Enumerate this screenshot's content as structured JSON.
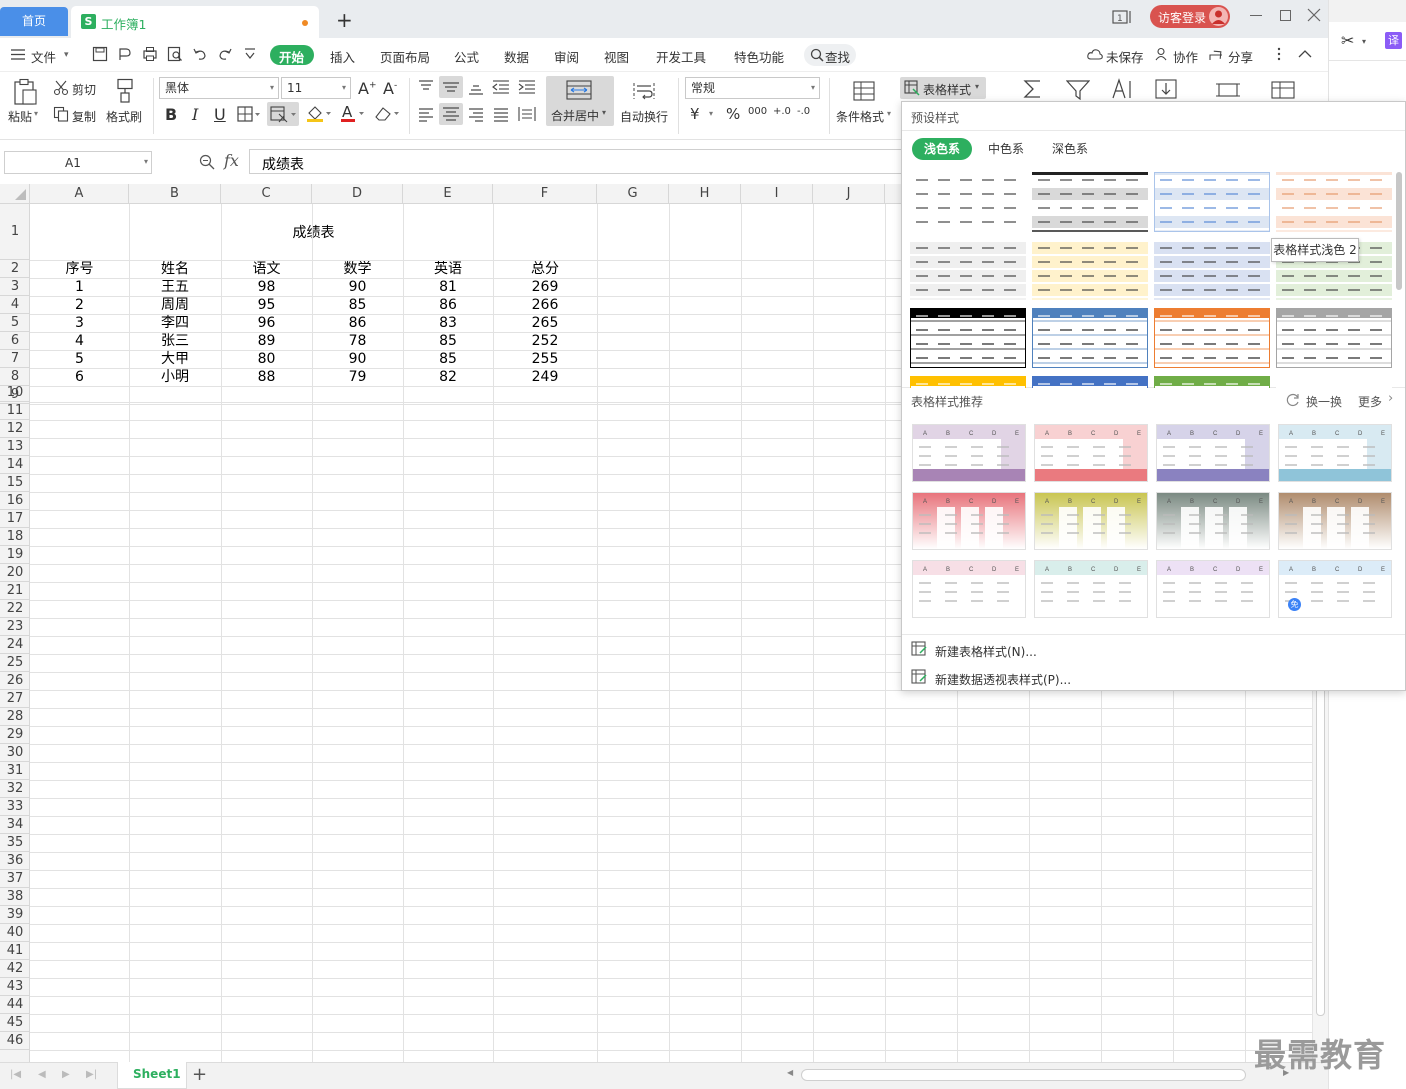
{
  "titlebar": {
    "home_tab": "首页",
    "doc_tab": "工作簿1",
    "doc_icon": "S",
    "new_tab": "+",
    "login": "访客登录",
    "accent": "#2daf5f",
    "login_color": "#d9534f"
  },
  "menubar": {
    "file": "文件",
    "items": [
      "开始",
      "插入",
      "页面布局",
      "公式",
      "数据",
      "审阅",
      "视图",
      "开发工具",
      "特色功能"
    ],
    "search": "查找",
    "unsaved": "未保存",
    "collab": "协作",
    "share": "分享"
  },
  "ribbon": {
    "paste": "粘贴",
    "cut": "剪切",
    "copy": "复制",
    "format_painter": "格式刷",
    "font_name": "黑体",
    "font_size": "11",
    "bold": "B",
    "italic": "I",
    "underline": "U",
    "merge_center": "合并居中",
    "wrap": "自动换行",
    "number_format": "常规",
    "currency": "¥",
    "percent": "%",
    "thousands": "000",
    "dec_inc": "+.0",
    "dec_dec": "-.0",
    "conditional": "条件格式",
    "table_style": "表格样式"
  },
  "formula_bar": {
    "name_box": "A1",
    "fx": "fx",
    "content": "成绩表"
  },
  "sheet": {
    "columns": [
      "A",
      "B",
      "C",
      "D",
      "E",
      "F",
      "G",
      "H",
      "I",
      "J"
    ],
    "title": "成绩表",
    "headers": [
      "序号",
      "姓名",
      "语文",
      "数学",
      "英语",
      "总分"
    ],
    "rows": [
      [
        "1",
        "王五",
        "98",
        "90",
        "81",
        "269"
      ],
      [
        "2",
        "周周",
        "95",
        "85",
        "86",
        "266"
      ],
      [
        "3",
        "李四",
        "96",
        "86",
        "83",
        "265"
      ],
      [
        "4",
        "张三",
        "89",
        "78",
        "85",
        "252"
      ],
      [
        "5",
        "大甲",
        "80",
        "90",
        "85",
        "255"
      ],
      [
        "6",
        "小明",
        "88",
        "79",
        "82",
        "249"
      ]
    ],
    "row_numbers": [
      "1",
      "2",
      "3",
      "4",
      "5",
      "6",
      "7",
      "8",
      "9",
      "10",
      "11",
      "12",
      "13",
      "14",
      "15",
      "16",
      "17",
      "18",
      "19",
      "20",
      "21",
      "22",
      "23",
      "24",
      "25",
      "26",
      "27",
      "28",
      "29",
      "30",
      "31",
      "32",
      "33",
      "34",
      "35",
      "36",
      "37",
      "38",
      "39",
      "40",
      "41",
      "42",
      "43",
      "44",
      "45",
      "46"
    ]
  },
  "bottombar": {
    "sheet_tab": "Sheet1",
    "add_sheet": "+"
  },
  "panel": {
    "preset_title": "预设样式",
    "tabs": [
      "浅色系",
      "中色系",
      "深色系"
    ],
    "tooltip": "表格样式浅色 2",
    "recommend_title": "表格样式推荐",
    "refresh": "换一换",
    "more": "更多",
    "new_table_style": "新建表格样式(N)...",
    "new_pivot_style": "新建数据透视表样式(P)...",
    "free_badge": "免",
    "preset_colors": [
      [
        "#ffffff",
        "#d9d9d9",
        "#dde6f3",
        "#fbe3d6"
      ],
      [
        "#efefef",
        "#fff2cc",
        "#d9e1f2",
        "#e2efda"
      ],
      [
        "#000000",
        "#4f81bd",
        "#ed7d31",
        "#a5a5a5"
      ],
      [
        "#ffc000",
        "#4472c4",
        "#70ad47",
        "#ffffff"
      ]
    ],
    "recommend_colors": [
      [
        "#a884b5",
        "#ea7a7f",
        "#8a82c0",
        "#8fc4d9"
      ],
      [
        "#e8747c",
        "#c9c552",
        "#7b8a82",
        "#b08d6e"
      ],
      [
        "#f2cad6",
        "#bfe3de",
        "#e1cdef",
        "#c5e0f3"
      ]
    ]
  },
  "sidebar": {
    "translate": "译",
    "scissors": "✂"
  },
  "watermark": "最需教育"
}
